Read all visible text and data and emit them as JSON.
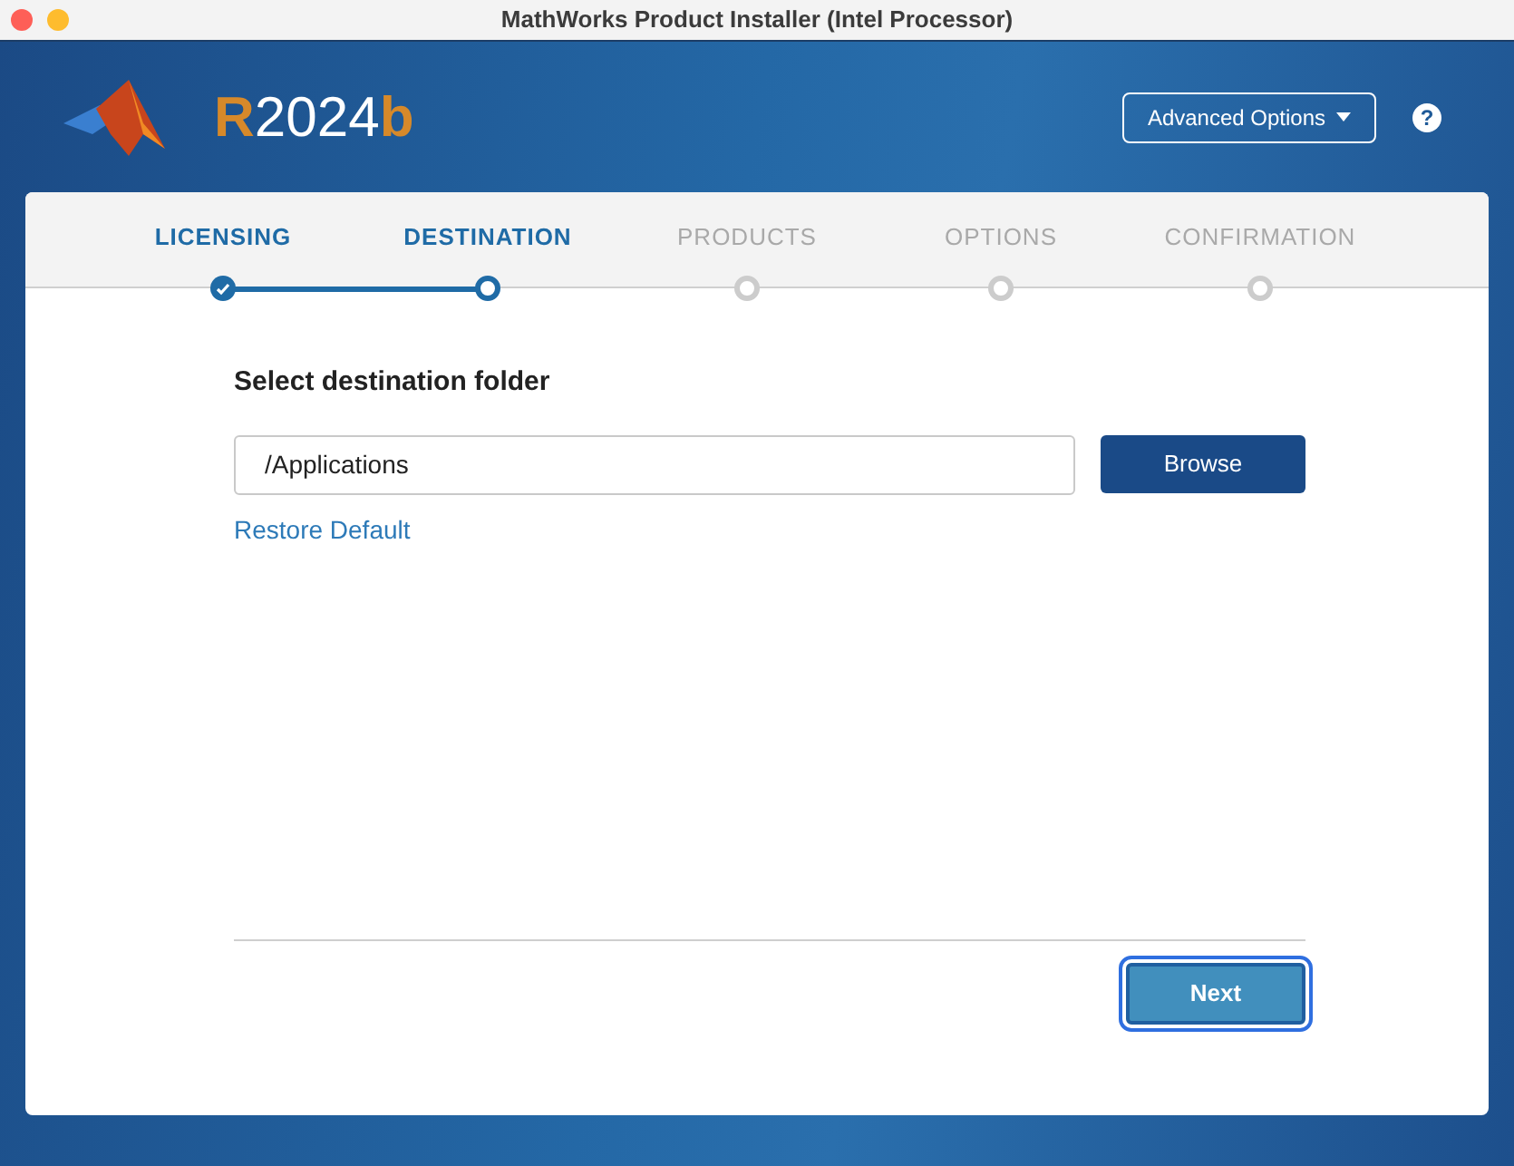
{
  "window": {
    "title": "MathWorks Product Installer (Intel Processor)"
  },
  "release": {
    "prefix": "R",
    "year": "2024",
    "suffix": "b"
  },
  "advanced_options": {
    "label": "Advanced Options"
  },
  "help": {
    "label": "?"
  },
  "steps": [
    {
      "label": "LICENSING",
      "kind": "done"
    },
    {
      "label": "DESTINATION",
      "kind": "current"
    },
    {
      "label": "PRODUCTS",
      "kind": "pending"
    },
    {
      "label": "OPTIONS",
      "kind": "pending"
    },
    {
      "label": "CONFIRMATION",
      "kind": "pending"
    }
  ],
  "heading": "Select destination folder",
  "folder": {
    "value": "/Applications"
  },
  "browse_button": "Browse",
  "restore_link": "Restore Default",
  "next_button": {
    "label": "Next",
    "focused": true
  }
}
